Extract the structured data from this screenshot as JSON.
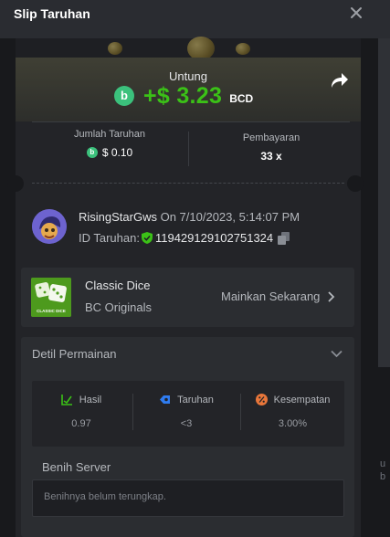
{
  "header": {
    "title": "Slip Taruhan"
  },
  "profit": {
    "label": "Untung",
    "value": "+$ 3.23",
    "currency": "BCD"
  },
  "bet_amount": {
    "label": "Jumlah Taruhan",
    "value": "$ 0.10"
  },
  "payout": {
    "label": "Pembayaran",
    "value": "33 x"
  },
  "player": {
    "name": "RisingStarGws",
    "datetime": "On 7/10/2023, 5:14:07 PM",
    "bet_id_label": "ID Taruhan:",
    "bet_id": "119429129102751324"
  },
  "game": {
    "name": "Classic Dice",
    "provider": "BC Originals",
    "play_label": "Mainkan Sekarang",
    "thumb_text": "CLASSIC DICE"
  },
  "details": {
    "title": "Detil Permainan",
    "result": {
      "label": "Hasil",
      "value": "0.97"
    },
    "bet": {
      "label": "Taruhan",
      "value": "<3"
    },
    "chance": {
      "label": "Kesempatan",
      "value": "3.00%"
    },
    "server_seed_label": "Benih Server",
    "server_seed_text": "Benihnya belum terungkap."
  },
  "side_text": "u\nb",
  "colors": {
    "accent_green": "#3bc117",
    "bcd_coin": "#3bc17c",
    "panel": "#2b2d31"
  },
  "icons": [
    "close-icon",
    "share-icon",
    "bcd-coin-icon",
    "verified-shield-icon",
    "copy-icon",
    "chevron-right-icon",
    "chevron-down-icon",
    "result-icon",
    "bet-icon",
    "chance-icon"
  ]
}
